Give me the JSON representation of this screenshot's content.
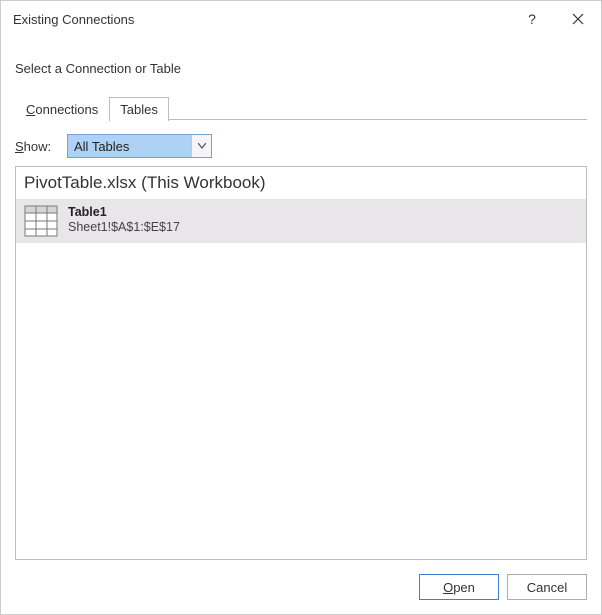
{
  "titlebar": {
    "title": "Existing Connections"
  },
  "instruction": "Select a Connection or Table",
  "tabs": {
    "connections": {
      "prefix": "C",
      "rest": "onnections"
    },
    "tables": {
      "label": "Tables"
    }
  },
  "show": {
    "label_prefix": "S",
    "label_rest": "how:",
    "selected": "All Tables"
  },
  "list": {
    "group_header": "PivotTable.xlsx (This Workbook)",
    "items": [
      {
        "title": "Table1",
        "subtitle": "Sheet1!$A$1:$E$17"
      }
    ]
  },
  "footer": {
    "open_prefix": "O",
    "open_rest": "pen",
    "cancel": "Cancel"
  }
}
